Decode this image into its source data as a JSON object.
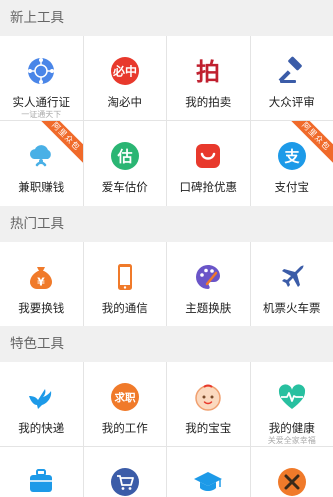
{
  "sections": [
    {
      "title": "新上工具",
      "items": [
        {
          "label": "实人通行证",
          "sublabel": "一证通天下",
          "icon": "network-icon"
        },
        {
          "label": "淘必中",
          "icon": "taobizhong-icon",
          "icon_text": "必中"
        },
        {
          "label": "我的拍卖",
          "icon": "auction-icon",
          "icon_text": "拍"
        },
        {
          "label": "大众评审",
          "icon": "gavel-icon"
        },
        {
          "label": "兼职赚钱",
          "icon": "cloud-hand-icon",
          "ribbon": "阿里众包"
        },
        {
          "label": "爱车估价",
          "icon": "car-valuation-icon",
          "icon_text": "估"
        },
        {
          "label": "口碑抢优惠",
          "icon": "koubei-icon"
        },
        {
          "label": "支付宝",
          "icon": "alipay-icon",
          "icon_text": "支",
          "ribbon": "阿里众包"
        }
      ]
    },
    {
      "title": "热门工具",
      "items": [
        {
          "label": "我要换钱",
          "icon": "money-bag-icon",
          "icon_text": "¥"
        },
        {
          "label": "我的通信",
          "icon": "phone-icon"
        },
        {
          "label": "主题换肤",
          "icon": "palette-icon"
        },
        {
          "label": "机票火车票",
          "icon": "airplane-icon"
        }
      ]
    },
    {
      "title": "特色工具",
      "items": [
        {
          "label": "我的快递",
          "icon": "bird-icon"
        },
        {
          "label": "我的工作",
          "icon": "job-icon",
          "icon_text": "求职"
        },
        {
          "label": "我的宝宝",
          "icon": "baby-icon"
        },
        {
          "label": "我的健康",
          "sublabel": "关爱全家幸福",
          "icon": "heart-pulse-icon"
        }
      ]
    }
  ],
  "partial_row": [
    {
      "icon": "luggage-icon"
    },
    {
      "icon": "cart-icon"
    },
    {
      "icon": "graduation-cap-icon"
    },
    {
      "icon": "tools-icon"
    }
  ],
  "colors": {
    "blue": "#4a86e8",
    "red": "#e8392c",
    "crimson": "#c0202f",
    "navy": "#3b5ca8",
    "sky": "#49b0e6",
    "green": "#2ab573",
    "orange": "#f07a2a",
    "purple": "#6a55c8",
    "teal": "#28c0a0"
  }
}
